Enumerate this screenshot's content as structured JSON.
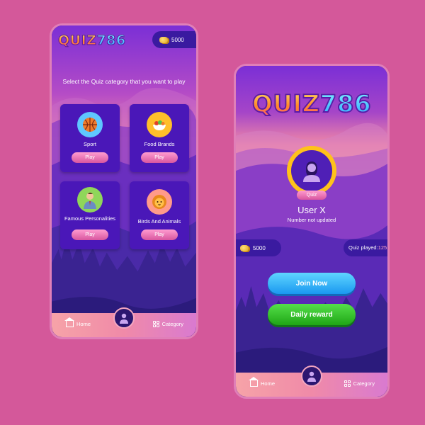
{
  "app": {
    "logo_word": "QUIZ",
    "logo_number": "786"
  },
  "colors": {
    "background": "#d4589a",
    "card": "#4a17b8",
    "play_button": "#d8569f",
    "join_button": "#1a98f0",
    "daily_button": "#1fa516",
    "avatar_ring": "#ffc21a"
  },
  "category_screen": {
    "coins": "5000",
    "heading": "Select the Quiz category that you want to play",
    "categories": [
      {
        "label": "Sport",
        "button": "Play",
        "icon": "basketball-icon"
      },
      {
        "label": "Food Brands",
        "button": "Play",
        "icon": "food-bowl-icon"
      },
      {
        "label": "Famous Personalities",
        "button": "Play",
        "icon": "person-icon"
      },
      {
        "label": "Birds And Animals",
        "button": "Play",
        "icon": "lion-icon"
      }
    ],
    "nav": {
      "home": "Home",
      "category": "Category"
    }
  },
  "profile_screen": {
    "badge": "Quiz",
    "username": "User X",
    "phone_status": "Number not updated",
    "coins": "5000",
    "quiz_played_label": "Quiz played:",
    "quiz_played_value": "125",
    "join_button": "Join Now",
    "daily_button": "Daily reward",
    "nav": {
      "home": "Home",
      "category": "Category"
    }
  }
}
